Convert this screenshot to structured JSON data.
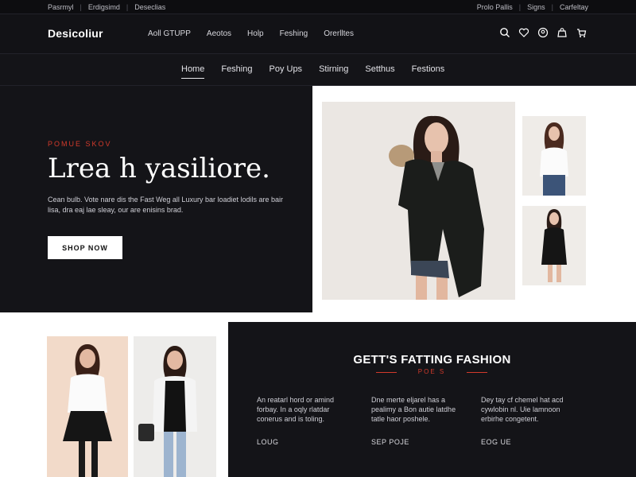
{
  "utility_bar": {
    "left_links": [
      "Pasrmyl",
      "Erdigsimd",
      "Deseclias"
    ],
    "right_links": [
      "Prolo Pallis",
      "Signs",
      "Carfeltay"
    ]
  },
  "header": {
    "logo": "Desicoliur",
    "nav": [
      "Aoll GTUPP",
      "Aeotos",
      "Holp",
      "Feshing",
      "Orerlltes"
    ],
    "icons": [
      "search-icon",
      "heart-icon",
      "user-icon",
      "bag-icon",
      "cart-icon"
    ]
  },
  "subnav": {
    "items": [
      "Home",
      "Feshing",
      "Poy Ups",
      "Stirning",
      "Setthus",
      "Festions"
    ],
    "active": "Home"
  },
  "hero": {
    "eyebrow": "POMUE SKOV",
    "headline": "Lrea h yasiliore.",
    "body": "Cean bulb. Vote nare dis the Fast Weg all Luxury bar loadiet lodils are bair lisa, dra eaj lae sleay, our are enisins brad.",
    "cta": "SHOP NOW"
  },
  "feature": {
    "title": "GETT'S FATTING FASHION",
    "subtitle": "POE S",
    "columns": [
      {
        "text": "An reatarl hord or amind forbay. In a oqly rlatdar conerus and is toling.",
        "link": "LOUG"
      },
      {
        "text": "Dne merte eljarel has a pealimy a Bon autie latdhe tatle haor poshele.",
        "link": "SEP POJE"
      },
      {
        "text": "Dey tay cf chemel hat acd cywlobin nl. Uie lamnoon erbirhe congetent.",
        "link": "EOG UE"
      }
    ]
  },
  "colors": {
    "accent": "#d23a2b",
    "dark_bg": "#141418",
    "light_bg": "#ffffff"
  }
}
